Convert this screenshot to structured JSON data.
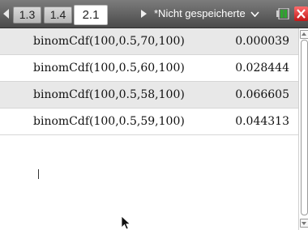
{
  "tabs": [
    {
      "label": "1.3",
      "active": false
    },
    {
      "label": "1.4",
      "active": false
    },
    {
      "label": "2.1",
      "active": true
    }
  ],
  "document_title": "*Nicht gespeicherte",
  "icons": {
    "back": "triangle-left-icon",
    "forward": "triangle-right-icon",
    "menu": "chevron-down-icon",
    "battery": "battery-icon",
    "close": "close-icon",
    "pointer": "mouse-pointer-icon"
  },
  "history": [
    {
      "expression": "binomCdf(100,0.5,70,100)",
      "result": "0.000039"
    },
    {
      "expression": "binomCdf(100,0.5,60,100)",
      "result": "0.028444"
    },
    {
      "expression": "binomCdf(100,0.5,58,100)",
      "result": "0.066605"
    },
    {
      "expression": "binomCdf(100,0.5,59,100)",
      "result": "0.044313"
    }
  ],
  "colors": {
    "titlebar": "#5f5f5f",
    "row_shade": "#e8e8e8",
    "close": "#d42a2a",
    "battery_green": "#2fa52f"
  }
}
